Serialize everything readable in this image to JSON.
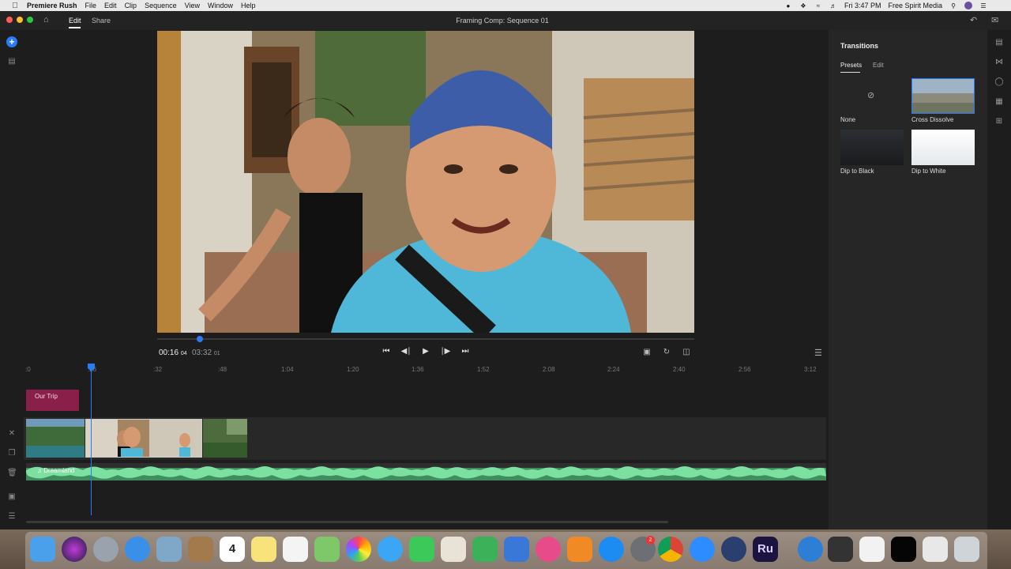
{
  "menubar": {
    "app_name": "Premiere Rush",
    "items": [
      "File",
      "Edit",
      "Clip",
      "Sequence",
      "View",
      "Window",
      "Help"
    ],
    "clock": "Fri 3:47 PM",
    "user": "Free Spirit Media"
  },
  "titlebar": {
    "tabs": [
      "Edit",
      "Share"
    ],
    "active_tab": "Edit",
    "title": "Framing Comp: Sequence 01"
  },
  "playback": {
    "current_time": "00:16",
    "current_frames": "04",
    "total_time": "03:32",
    "total_frames": "01",
    "progress": 0.075
  },
  "timeline": {
    "ruler_labels": [
      ":0",
      ":16",
      ":32",
      ":48",
      "1:04",
      "1:20",
      "1:36",
      "1:52",
      "2:08",
      "2:24",
      "2:40",
      "2:56",
      "3:12"
    ],
    "title_clip": "Our Trip",
    "audio_clip": "Dreamland"
  },
  "panel": {
    "title": "Transitions",
    "tabs": [
      "Presets",
      "Edit"
    ],
    "active_tab": "Presets",
    "transitions": [
      {
        "label": "None"
      },
      {
        "label": "Cross Dissolve"
      },
      {
        "label": "Dip to Black"
      },
      {
        "label": "Dip to White"
      }
    ]
  },
  "dock": {
    "calendar_day": "4",
    "system_prefs_badge": "2",
    "rush_label": "Ru",
    "icons": [
      "finder-icon",
      "siri-icon",
      "launchpad-icon",
      "safari-icon",
      "preview-icon",
      "notes-folder-icon",
      "calendar-icon",
      "stickies-icon",
      "reminders-icon",
      "maps-icon",
      "photos-icon",
      "messages-icon",
      "facetime-icon",
      "keynote-icon",
      "numbers-icon",
      "keynote-presentation-icon",
      "itunes-icon",
      "books-icon",
      "app-store-icon",
      "system-preferences-icon",
      "chrome-icon",
      "zoom-icon",
      "quicktime-icon",
      "premiere-rush-icon",
      "globe-icon",
      "keyboard-icon",
      "document-icon",
      "terminal-icon",
      "mail-icon",
      "trash-icon"
    ]
  },
  "colors": {
    "accent": "#2a7bf6",
    "title_clip": "#8a1f4a",
    "audio_wave": "#3f8d5d"
  }
}
